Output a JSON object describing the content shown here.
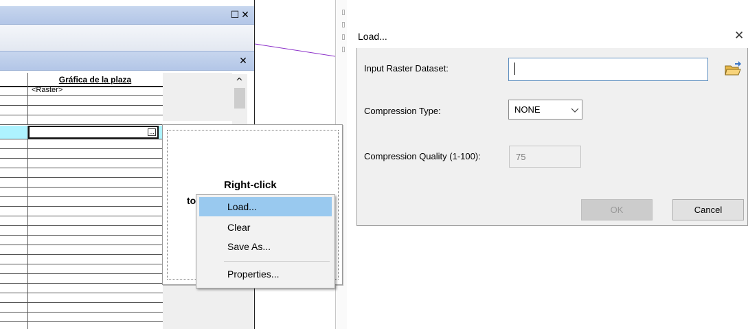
{
  "panel": {
    "restore_glyph": "☐",
    "close_glyph": "✕",
    "close2_glyph": "✕",
    "scroll_up_glyph": "^"
  },
  "grid": {
    "column_header": "Gráfica de la plaza",
    "first_cell": "<Raster>",
    "edit_button_glyph": "..."
  },
  "preview": {
    "title": "Right-click",
    "partial_text": "to"
  },
  "context_menu": {
    "items": [
      {
        "label": "Load..."
      },
      {
        "label": "Clear"
      },
      {
        "label": "Save As..."
      },
      {
        "label": "Properties..."
      }
    ]
  },
  "dialog": {
    "title": "Load...",
    "close_glyph": "✕",
    "input_raster_label": "Input Raster Dataset:",
    "input_raster_value": "",
    "compression_type_label": "Compression Type:",
    "compression_type_value": "NONE",
    "compression_quality_label": "Compression Quality (1-100):",
    "compression_quality_value": "75",
    "ok_label": "OK",
    "cancel_label": "Cancel"
  },
  "colors": {
    "panel_title": "#b3c6e7",
    "selection": "#99c9ef",
    "selected_row": "#aef3ff",
    "map_line": "#8b2fc9"
  },
  "icons": {
    "folder": "folder-open-icon",
    "chevron": "chevron-down-icon"
  }
}
